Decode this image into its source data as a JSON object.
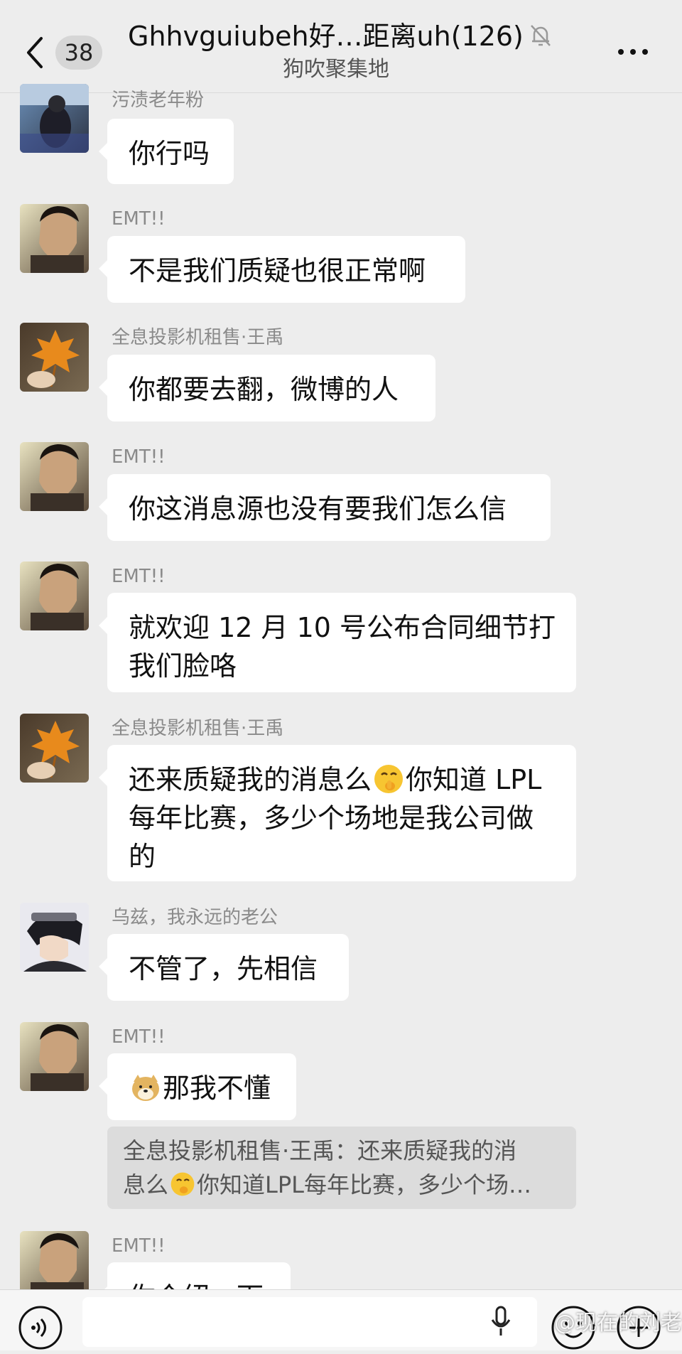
{
  "header": {
    "back_count": "38",
    "title": "Ghhvguiubeh好…距离uh(126)",
    "subtitle": "狗吹聚集地"
  },
  "messages": [
    {
      "sender": "污渍老年粉",
      "lines": [
        "你行吗"
      ],
      "avatar": "avatar-dark-figure"
    },
    {
      "sender": "EMT!!",
      "lines": [
        "不是我们质疑也很正常啊"
      ],
      "avatar": "avatar-man-portrait"
    },
    {
      "sender": "全息投影机租售·王禹",
      "lines": [
        "你都要去翻，微博的人"
      ],
      "avatar": "avatar-maple-leaf"
    },
    {
      "sender": "EMT!!",
      "lines": [
        "你这消息源也没有要我们怎么信"
      ],
      "avatar": "avatar-man-portrait"
    },
    {
      "sender": "EMT!!",
      "lines": [
        "就欢迎 12 月 10 号公布合同细节打",
        "我们脸咯"
      ],
      "avatar": "avatar-man-portrait"
    },
    {
      "sender": "全息投影机租售·王禹",
      "line1_a": "还来质疑我的消息么",
      "line1_b": "你知道 LPL",
      "line2": "每年比赛，多少个场地是我公司做",
      "line3": "的",
      "avatar": "avatar-maple-leaf"
    },
    {
      "sender": "乌兹，我永远的老公",
      "lines": [
        "不管了，先相信"
      ],
      "avatar": "avatar-anime-boy"
    },
    {
      "sender": "EMT!!",
      "text": "那我不懂",
      "avatar": "avatar-man-portrait"
    },
    {
      "sender": "EMT!!",
      "partial": "你介绍一下",
      "avatar": "avatar-man-portrait"
    }
  ],
  "quote": {
    "line1": "全息投影机租售·王禹：还来质疑我的消",
    "line2_a": "息么",
    "line2_b": "你知道LPL每年比赛，多少个场…"
  },
  "watermark": "@现在的刘老板",
  "colors": {
    "background": "#ededed",
    "bubble": "#ffffff",
    "quote": "#dcdcdc"
  }
}
